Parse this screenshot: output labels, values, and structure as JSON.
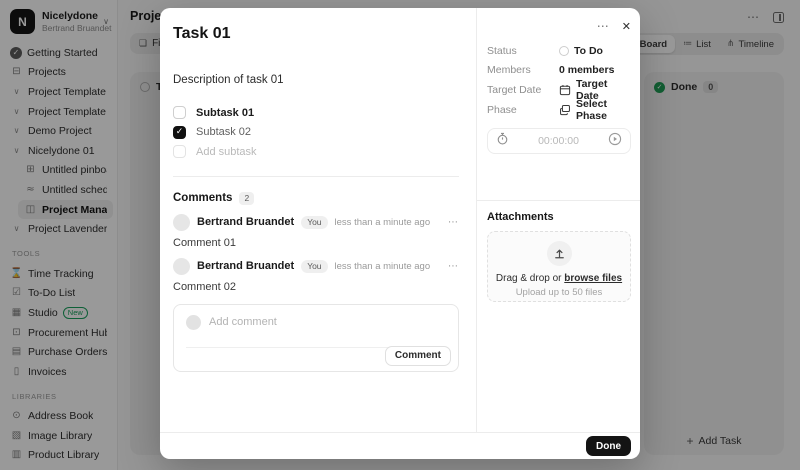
{
  "colors": {
    "accent_green": "#18a05c",
    "done_green": "#1f9d55",
    "button_black": "#141414"
  },
  "sidebar": {
    "workspace": {
      "logo_initial": "N",
      "name": "Nicelydone",
      "user": "Bertrand Bruandet"
    },
    "nav": [
      {
        "label": "Getting Started",
        "icon": "check-circle-icon",
        "glyph": "✓",
        "filled": true
      },
      {
        "label": "Projects",
        "icon": "briefcase-icon",
        "glyph": "⊟"
      },
      {
        "label": "Project Template - Interior ...",
        "icon": "chevron-down-icon",
        "glyph": "∨",
        "chev": true
      },
      {
        "label": "Project Template - Interior ...",
        "icon": "chevron-down-icon",
        "glyph": "∨",
        "chev": true
      },
      {
        "label": "Demo Project",
        "icon": "chevron-down-icon",
        "glyph": "∨",
        "chev": true
      },
      {
        "label": "Nicelydone 01",
        "icon": "chevron-down-icon",
        "glyph": "∨",
        "chev": true
      },
      {
        "label": "Untitled pinboard",
        "icon": "pinboard-icon",
        "glyph": "⊞",
        "indent": true
      },
      {
        "label": "Untitled schedule",
        "icon": "schedule-icon",
        "glyph": "≈",
        "indent": true
      },
      {
        "label": "Project Management",
        "icon": "kanban-icon",
        "glyph": "◫",
        "indent": true,
        "active": true
      },
      {
        "label": "Project Lavender",
        "icon": "chevron-down-icon",
        "glyph": "∨",
        "chev": true
      }
    ],
    "tools_label": "TOOLS",
    "tools": [
      {
        "label": "Time Tracking",
        "icon": "hourglass-icon",
        "glyph": "⌛"
      },
      {
        "label": "To-Do List",
        "icon": "clipboard-icon",
        "glyph": "☑"
      },
      {
        "label": "Studio",
        "icon": "grid-icon",
        "glyph": "▦",
        "badge": "New"
      },
      {
        "label": "Procurement Hub",
        "icon": "procurement-icon",
        "glyph": "⊡"
      },
      {
        "label": "Purchase Orders",
        "icon": "orders-icon",
        "glyph": "▤"
      },
      {
        "label": "Invoices",
        "icon": "invoice-icon",
        "glyph": "▯"
      }
    ],
    "libraries_label": "LIBRARIES",
    "libraries": [
      {
        "label": "Address Book",
        "icon": "person-icon",
        "glyph": "⊙"
      },
      {
        "label": "Image Library",
        "icon": "image-icon",
        "glyph": "▧"
      },
      {
        "label": "Product Library",
        "icon": "book-icon",
        "glyph": "▥"
      }
    ]
  },
  "header": {
    "title": "Project Management",
    "kebab_glyph": "⋯",
    "filter_label": "Filter",
    "filter_icon_glyph": "❏",
    "views": [
      {
        "label": "Board",
        "icon": "board-icon",
        "glyph": "◫",
        "active": true
      },
      {
        "label": "List",
        "icon": "list-icon",
        "glyph": "≔"
      },
      {
        "label": "Timeline",
        "icon": "timeline-icon",
        "glyph": "⋔"
      }
    ]
  },
  "board": {
    "todo": {
      "label": "To Do"
    },
    "done": {
      "label": "Done",
      "count": "0",
      "check_glyph": "✓"
    },
    "add_task_label": "Add Task",
    "add_task_plus": "+"
  },
  "modal": {
    "title": "Task 01",
    "description": "Description of task 01",
    "kebab_glyph": "⋯",
    "close_glyph": "✕",
    "subtasks": [
      {
        "label": "Subtask 01",
        "checked": false
      },
      {
        "label": "Subtask 02",
        "checked": true
      }
    ],
    "add_subtask_placeholder": "Add subtask",
    "comments": {
      "heading": "Comments",
      "count": "2",
      "kebab_glyph": "⋯",
      "items": [
        {
          "author": "Bertrand Bruandet",
          "badge": "You",
          "time": "less than a minute ago",
          "text": "Comment 01"
        },
        {
          "author": "Bertrand Bruandet",
          "badge": "You",
          "time": "less than a minute ago",
          "text": "Comment 02"
        }
      ],
      "add_placeholder": "Add comment",
      "submit_label": "Comment"
    },
    "details": {
      "status_label": "Status",
      "status_value": "To Do",
      "members_label": "Members",
      "members_value": "0 members",
      "target_date_label": "Target Date",
      "target_date_value": "Target Date",
      "phase_label": "Phase",
      "phase_value": "Select Phase",
      "timer_value": "00:00:00"
    },
    "attachments": {
      "heading": "Attachments",
      "drop_prefix": "Drag & drop or ",
      "browse_label": "browse files",
      "hint": "Upload up to 50 files"
    },
    "footer": {
      "done_label": "Done"
    }
  }
}
